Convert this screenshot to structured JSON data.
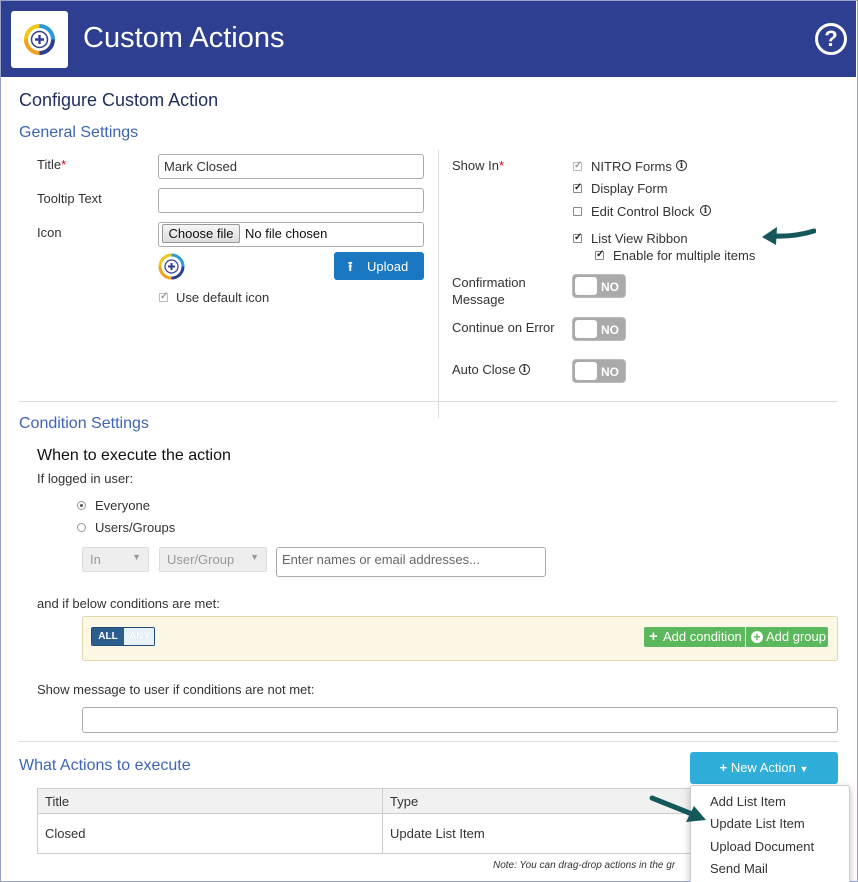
{
  "header": {
    "title": "Custom Actions",
    "help_icon": "?",
    "bg_color": "#2e3f91"
  },
  "page_title": "Configure Custom Action",
  "general": {
    "heading": "General Settings",
    "title_label": "Title",
    "required_mark": "*",
    "title_value": "Mark Closed",
    "tooltip_label": "Tooltip Text",
    "tooltip_value": "",
    "icon_label": "Icon",
    "choose_file_label": "Choose file",
    "no_file_text": "No file chosen",
    "upload_label": "Upload",
    "use_default_icon_label": "Use default icon",
    "use_default_icon_checked": true
  },
  "show_in": {
    "label": "Show In",
    "nitro_forms": "NITRO Forms",
    "display_form": "Display Form",
    "edit_control_block": "Edit Control Block",
    "list_view_ribbon": "List View Ribbon",
    "enable_multiple": "Enable for multiple items",
    "states": {
      "nitro_forms": true,
      "display_form": true,
      "edit_control_block": false,
      "list_view_ribbon": true,
      "enable_multiple": true
    }
  },
  "toggles": {
    "confirmation_label": "Confirmation Message",
    "continue_label": "Continue on Error",
    "auto_close_label": "Auto Close",
    "off_text": "NO"
  },
  "conditions": {
    "heading": "Condition Settings",
    "when_heading": "When to execute the action",
    "if_logged_in": "If logged in user:",
    "everyone": "Everyone",
    "users_groups": "Users/Groups",
    "in_select": "In",
    "user_group_select": "User/Group",
    "names_placeholder": "Enter names or email addresses...",
    "below_conditions": "and if below conditions are met:",
    "all_label": "ALL",
    "any_label": "ANY",
    "add_condition": "Add condition",
    "add_group": "Add group",
    "show_message_label": "Show message to user if conditions are not met:",
    "message_value": ""
  },
  "actions": {
    "heading": "What Actions to execute",
    "new_action_label": "New Action",
    "columns": [
      "Title",
      "Type"
    ],
    "rows": [
      {
        "title": "Closed",
        "type": "Update List Item"
      }
    ],
    "note": "Note: You can drag-drop actions in the gr",
    "menu_items": [
      "Add List Item",
      "Update List Item",
      "Upload Document",
      "Send Mail"
    ]
  },
  "colors": {
    "accent_blue": "#1a78c2",
    "new_action_blue": "#2faed9",
    "green": "#5cb85c",
    "arrow_teal": "#14585c"
  }
}
